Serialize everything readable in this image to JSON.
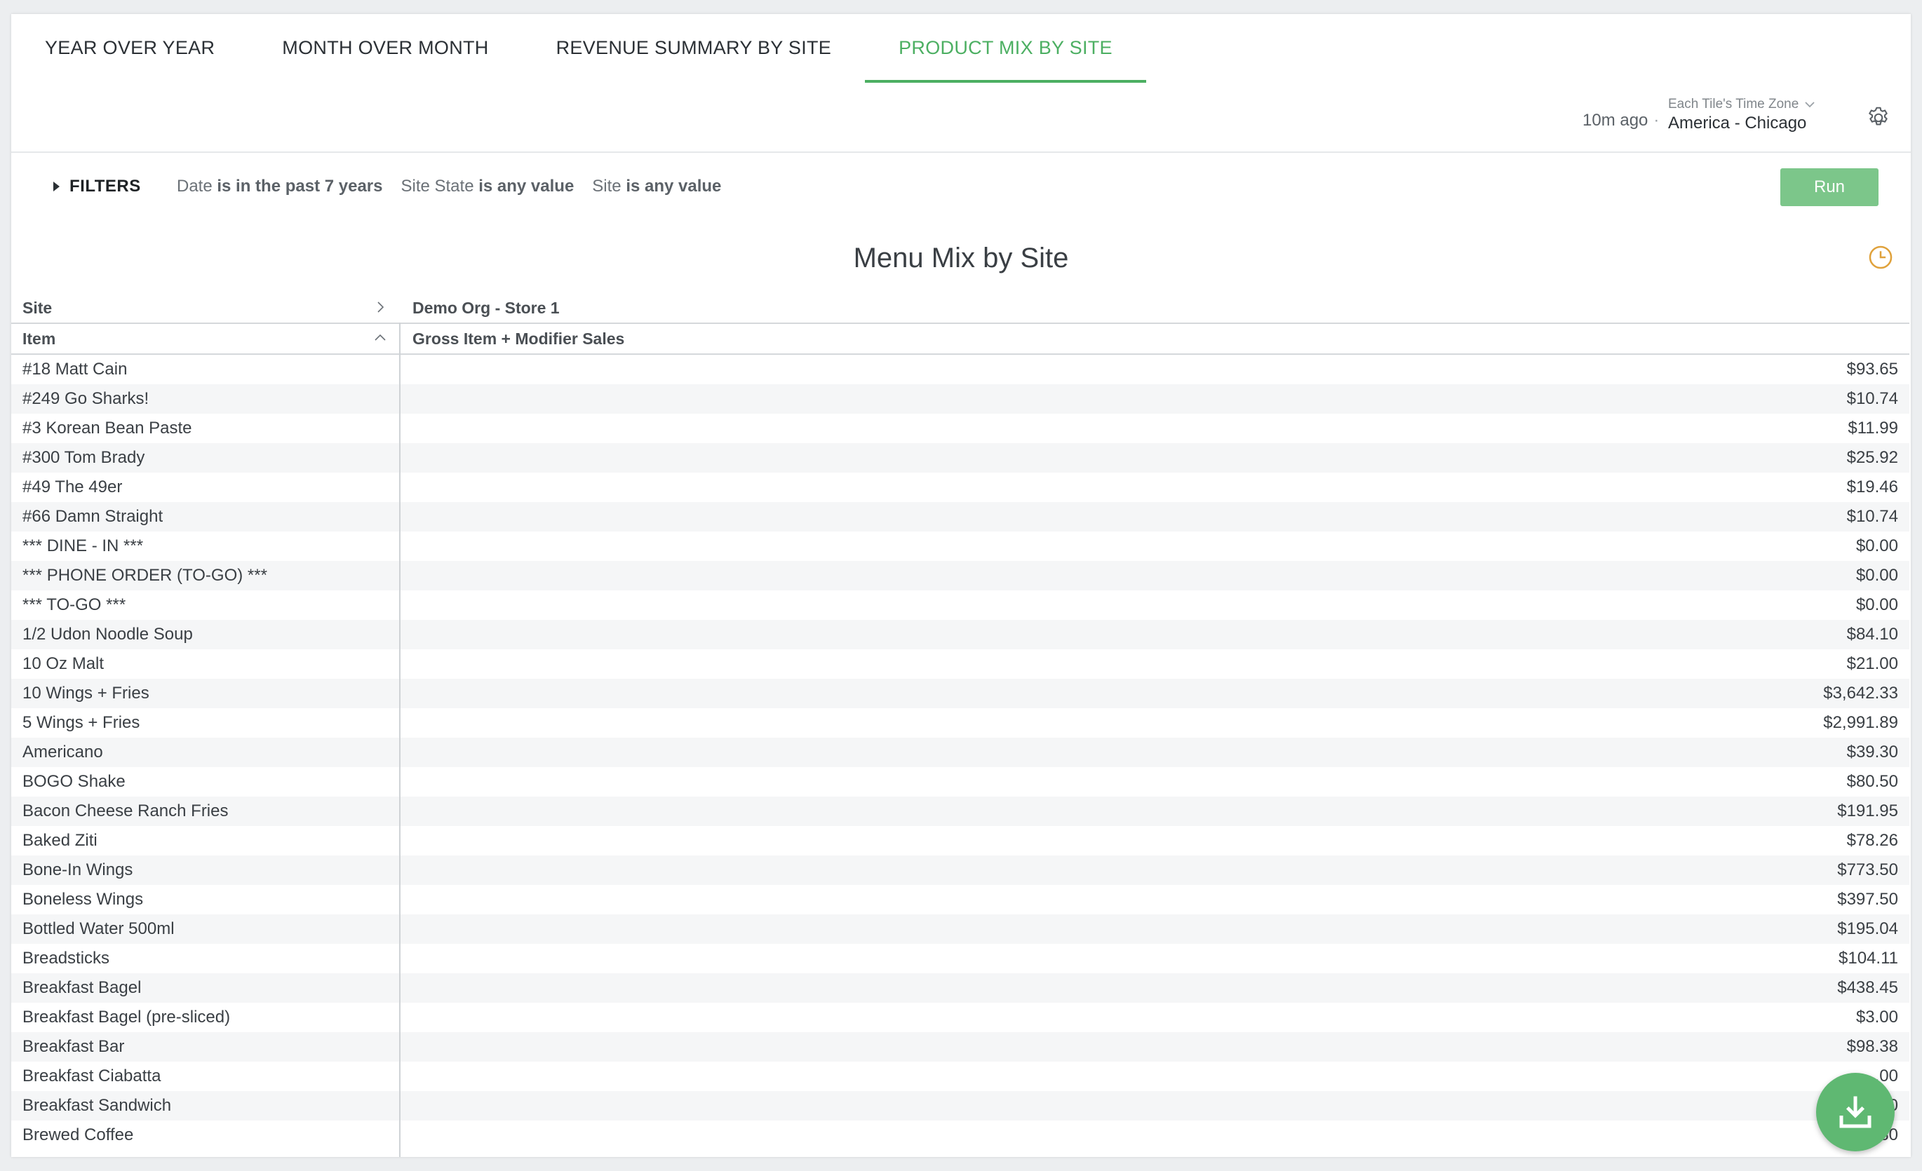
{
  "tabs": [
    {
      "label": "YEAR OVER YEAR"
    },
    {
      "label": "MONTH OVER MONTH"
    },
    {
      "label": "REVENUE SUMMARY BY SITE"
    },
    {
      "label": "PRODUCT MIX BY SITE"
    }
  ],
  "timezone": {
    "ago": "10m ago",
    "label": "Each Tile's Time Zone",
    "value": "America - Chicago"
  },
  "filters": {
    "toggle_label": "FILTERS",
    "items": [
      {
        "field": "Date",
        "condition": "is in the past 7 years"
      },
      {
        "field": "Site State",
        "condition": "is any value"
      },
      {
        "field": "Site",
        "condition": "is any value"
      }
    ],
    "run_label": "Run"
  },
  "tile": {
    "title": "Menu Mix by Site"
  },
  "table": {
    "pivot_header": "Site",
    "pivot_value": "Demo Org - Store 1",
    "row_header": "Item",
    "measure_header": "Gross Item + Modifier Sales",
    "rows": [
      {
        "item": "#18 Matt Cain",
        "value": "$93.65"
      },
      {
        "item": "#249 Go Sharks!",
        "value": "$10.74"
      },
      {
        "item": "#3 Korean Bean Paste",
        "value": "$11.99"
      },
      {
        "item": "#300 Tom Brady",
        "value": "$25.92"
      },
      {
        "item": "#49 The 49er",
        "value": "$19.46"
      },
      {
        "item": "#66 Damn Straight",
        "value": "$10.74"
      },
      {
        "item": "*** DINE - IN ***",
        "value": "$0.00"
      },
      {
        "item": "*** PHONE ORDER (TO-GO) ***",
        "value": "$0.00"
      },
      {
        "item": "*** TO-GO ***",
        "value": "$0.00"
      },
      {
        "item": "1/2 Udon Noodle Soup",
        "value": "$84.10"
      },
      {
        "item": "10 Oz Malt",
        "value": "$21.00"
      },
      {
        "item": "10 Wings + Fries",
        "value": "$3,642.33"
      },
      {
        "item": "5 Wings + Fries",
        "value": "$2,991.89"
      },
      {
        "item": "Americano",
        "value": "$39.30"
      },
      {
        "item": "BOGO Shake",
        "value": "$80.50"
      },
      {
        "item": "Bacon Cheese Ranch Fries",
        "value": "$191.95"
      },
      {
        "item": "Baked Ziti",
        "value": "$78.26"
      },
      {
        "item": "Bone-In Wings",
        "value": "$773.50"
      },
      {
        "item": "Boneless Wings",
        "value": "$397.50"
      },
      {
        "item": "Bottled Water 500ml",
        "value": "$195.04"
      },
      {
        "item": "Breadsticks",
        "value": "$104.11"
      },
      {
        "item": "Breakfast Bagel",
        "value": "$438.45"
      },
      {
        "item": "Breakfast Bagel (pre-sliced)",
        "value": "$3.00"
      },
      {
        "item": "Breakfast Bar",
        "value": "$98.38"
      },
      {
        "item": "Breakfast Ciabatta",
        "value": ".00"
      },
      {
        "item": "Breakfast Sandwich",
        "value": ".00"
      },
      {
        "item": "Brewed Coffee",
        "value": ".80"
      }
    ]
  },
  "colors": {
    "accent": "#4caf62",
    "run_button": "#7cc68a",
    "fab": "#5fb872",
    "clock_icon": "#e0a23c"
  },
  "icons": [
    "gear-icon",
    "chevron-down-icon",
    "caret-right-icon",
    "clock-icon",
    "chevron-right-icon",
    "chevron-up-icon",
    "download-icon"
  ]
}
